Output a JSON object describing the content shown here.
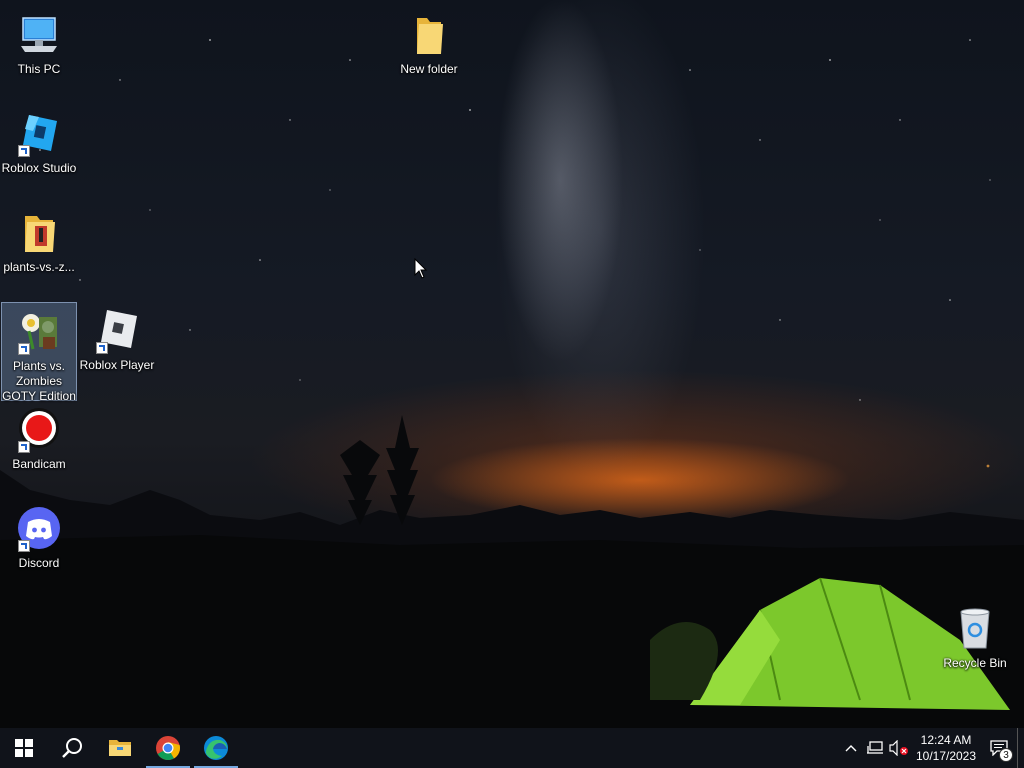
{
  "desktop": {
    "icons": [
      {
        "label": "This PC",
        "icon": "this-pc-icon",
        "shortcut": false
      },
      {
        "label": "New folder",
        "icon": "folder-icon",
        "shortcut": false
      },
      {
        "label": "Roblox Studio",
        "icon": "roblox-studio-icon",
        "shortcut": true
      },
      {
        "label": "plants-vs.-z...",
        "icon": "zip-folder-icon",
        "shortcut": false
      },
      {
        "label": "Plants vs. Zombies GOTY Edition",
        "icon": "plants-vs-zombies-icon",
        "shortcut": true,
        "selected": true
      },
      {
        "label": "Roblox Player",
        "icon": "roblox-player-icon",
        "shortcut": true
      },
      {
        "label": "Bandicam",
        "icon": "bandicam-icon",
        "shortcut": true
      },
      {
        "label": "Discord",
        "icon": "discord-icon",
        "shortcut": true
      },
      {
        "label": "Recycle Bin",
        "icon": "recycle-bin-icon",
        "shortcut": false
      }
    ]
  },
  "taskbar": {
    "pinned": [
      {
        "name": "start-button",
        "icon": "windows-logo-icon"
      },
      {
        "name": "search-button",
        "icon": "search-icon"
      },
      {
        "name": "file-explorer-button",
        "icon": "file-explorer-icon"
      },
      {
        "name": "chrome-button",
        "icon": "chrome-icon",
        "running": true
      },
      {
        "name": "edge-button",
        "icon": "edge-icon",
        "running": true
      }
    ],
    "tray": {
      "icons": [
        "chevron-up-icon",
        "network-icon",
        "volume-muted-icon"
      ],
      "time": "12:24 AM",
      "date": "10/17/2023",
      "notification_count": "3"
    }
  },
  "colors": {
    "taskbar": "#10131a",
    "running_indicator": "#76a8e0",
    "selection": "#82a0c8"
  }
}
